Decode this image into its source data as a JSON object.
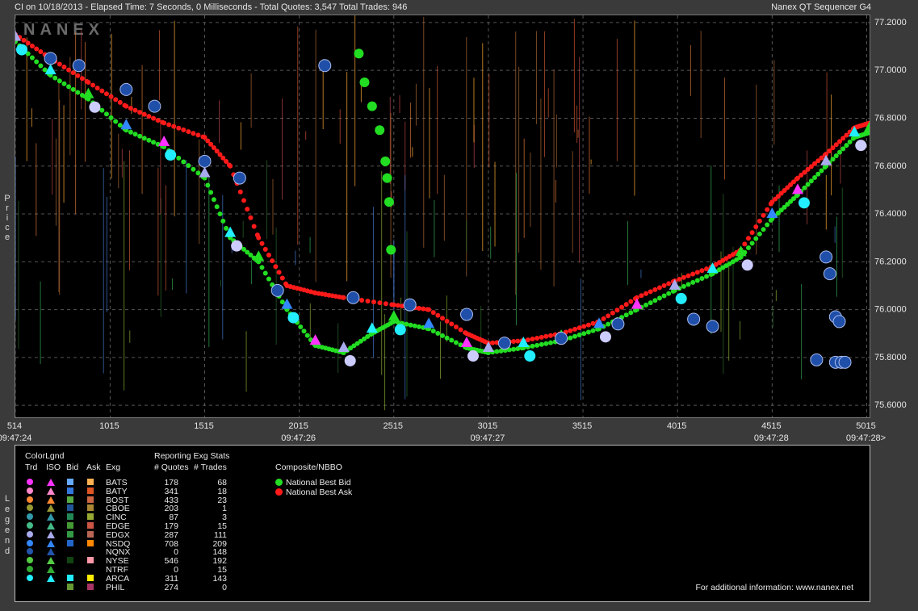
{
  "header": {
    "left": "CI on 10/18/2013  -  Elapsed Time: 7 Seconds, 0 Milliseconds  -  Total Quotes: 3,547  Total Trades: 946",
    "right": "Nanex QT Sequencer G4"
  },
  "watermark": "NANEX",
  "side_labels": {
    "price": "Price",
    "legend": "Legend"
  },
  "chart_data": {
    "type": "scatter",
    "ylim": [
      75.55,
      77.23
    ],
    "xlim": [
      514,
      5030
    ],
    "y_ticks": [
      "77.2000",
      "77.0000",
      "76.8000",
      "76.6000",
      "76.4000",
      "76.2000",
      "76.0000",
      "75.8000",
      "75.6000"
    ],
    "y_tick_values": [
      77.2,
      77.0,
      76.8,
      76.6,
      76.4,
      76.2,
      76.0,
      75.8,
      75.6
    ],
    "x_ticks": [
      "514",
      "1015",
      "1515",
      "2015",
      "2515",
      "3015",
      "3515",
      "4015",
      "4515",
      "5015"
    ],
    "x_tick_values": [
      514,
      1015,
      1515,
      2015,
      2515,
      3015,
      3515,
      4015,
      4515,
      5015
    ],
    "time_labels": [
      {
        "x": 514,
        "label": "09:47:24"
      },
      {
        "x": 2015,
        "label": "09:47:26"
      },
      {
        "x": 3015,
        "label": "09:47:27"
      },
      {
        "x": 4515,
        "label": "09:47:28"
      },
      {
        "x": 5015,
        "label": "09:47:28>"
      }
    ],
    "series": [
      {
        "name": "National Best Ask",
        "color": "#ff1a1a",
        "points": [
          [
            514,
            77.15
          ],
          [
            700,
            77.05
          ],
          [
            900,
            76.95
          ],
          [
            1100,
            76.85
          ],
          [
            1300,
            76.78
          ],
          [
            1515,
            76.72
          ],
          [
            1650,
            76.6
          ],
          [
            1800,
            76.3
          ],
          [
            1950,
            76.1
          ],
          [
            2100,
            76.07
          ],
          [
            2250,
            76.05
          ],
          [
            2515,
            76.02
          ],
          [
            2700,
            76.0
          ],
          [
            2900,
            75.9
          ],
          [
            3015,
            75.86
          ],
          [
            3200,
            75.87
          ],
          [
            3400,
            75.9
          ],
          [
            3600,
            75.95
          ],
          [
            3800,
            76.05
          ],
          [
            4000,
            76.12
          ],
          [
            4200,
            76.18
          ],
          [
            4350,
            76.25
          ],
          [
            4515,
            76.45
          ],
          [
            4650,
            76.55
          ],
          [
            4800,
            76.65
          ],
          [
            4950,
            76.76
          ],
          [
            5030,
            76.78
          ]
        ]
      },
      {
        "name": "National Best Bid",
        "color": "#22dd22",
        "points": [
          [
            514,
            77.12
          ],
          [
            700,
            76.98
          ],
          [
            900,
            76.88
          ],
          [
            1100,
            76.75
          ],
          [
            1300,
            76.68
          ],
          [
            1515,
            76.55
          ],
          [
            1650,
            76.3
          ],
          [
            1800,
            76.2
          ],
          [
            1950,
            76.0
          ],
          [
            2100,
            75.85
          ],
          [
            2250,
            75.82
          ],
          [
            2400,
            75.9
          ],
          [
            2515,
            75.95
          ],
          [
            2700,
            75.92
          ],
          [
            2900,
            75.84
          ],
          [
            3015,
            75.82
          ],
          [
            3200,
            75.84
          ],
          [
            3400,
            75.87
          ],
          [
            3600,
            75.92
          ],
          [
            3800,
            76.0
          ],
          [
            4000,
            76.08
          ],
          [
            4200,
            76.15
          ],
          [
            4350,
            76.22
          ],
          [
            4515,
            76.38
          ],
          [
            4650,
            76.48
          ],
          [
            4800,
            76.6
          ],
          [
            4950,
            76.72
          ],
          [
            5030,
            76.74
          ]
        ]
      },
      {
        "name": "Trades",
        "color": "#1f4fa8",
        "points": [
          [
            700,
            77.05
          ],
          [
            850,
            77.02
          ],
          [
            1100,
            76.92
          ],
          [
            1250,
            76.85
          ],
          [
            1515,
            76.62
          ],
          [
            1700,
            76.55
          ],
          [
            1900,
            76.08
          ],
          [
            2150,
            77.02
          ],
          [
            2300,
            76.05
          ],
          [
            2600,
            76.02
          ],
          [
            2900,
            75.98
          ],
          [
            3100,
            75.86
          ],
          [
            3400,
            75.88
          ],
          [
            3700,
            75.94
          ],
          [
            4100,
            75.96
          ],
          [
            4200,
            75.93
          ],
          [
            4800,
            76.22
          ],
          [
            4820,
            76.15
          ],
          [
            4850,
            75.97
          ],
          [
            4870,
            75.95
          ],
          [
            4750,
            75.79
          ],
          [
            4850,
            75.78
          ],
          [
            4880,
            75.78
          ],
          [
            4900,
            75.78
          ]
        ]
      }
    ],
    "green_spike": [
      [
        2330,
        77.07
      ],
      [
        2360,
        76.95
      ],
      [
        2400,
        76.85
      ],
      [
        2440,
        76.75
      ],
      [
        2470,
        76.62
      ],
      [
        2480,
        76.55
      ],
      [
        2490,
        76.45
      ],
      [
        2500,
        76.25
      ]
    ]
  },
  "legend": {
    "title": "ColorLgnd",
    "stats_title": "Reporting Exg Stats",
    "columns": [
      "Trd",
      "ISO",
      "Bid",
      "Ask",
      "Exg",
      "# Quotes",
      "# Trades"
    ],
    "composite_title": "Composite/NBBO",
    "composite_items": [
      {
        "label": "National Best Bid",
        "color": "#22dd22"
      },
      {
        "label": "National Best Ask",
        "color": "#ff1a1a"
      }
    ],
    "exchanges": [
      {
        "exg": "BATS",
        "quotes": "178",
        "trades": "68",
        "trd": "#ff33ff",
        "iso": "#ff33ff",
        "bid": "#66aaff",
        "ask": "#ffb050"
      },
      {
        "exg": "BATY",
        "quotes": "341",
        "trades": "18",
        "trd": "#ff88cc",
        "iso": "#ff88cc",
        "bid": "#3377dd",
        "ask": "#dd5522"
      },
      {
        "exg": "BOST",
        "quotes": "433",
        "trades": "23",
        "trd": "#ff8833",
        "iso": "#ff8833",
        "bid": "#55aa44",
        "ask": "#cc6644"
      },
      {
        "exg": "CBOE",
        "quotes": "203",
        "trades": "1",
        "trd": "#999933",
        "iso": "#999933",
        "bid": "#225599",
        "ask": "#aa8833"
      },
      {
        "exg": "CINC",
        "quotes": "87",
        "trades": "3",
        "trd": "#3399aa",
        "iso": "#3399aa",
        "bid": "#228855",
        "ask": "#99aa33"
      },
      {
        "exg": "EDGE",
        "quotes": "179",
        "trades": "15",
        "trd": "#44bb88",
        "iso": "#44bb88",
        "bid": "#449933",
        "ask": "#cc5544"
      },
      {
        "exg": "EDGX",
        "quotes": "287",
        "trades": "111",
        "trd": "#aaaaee",
        "iso": "#aaaaee",
        "bid": "#339944",
        "ask": "#bb6655"
      },
      {
        "exg": "NSDQ",
        "quotes": "708",
        "trades": "209",
        "trd": "#3388ff",
        "iso": "#3388ff",
        "bid": "#2266cc",
        "ask": "#ff8800"
      },
      {
        "exg": "NQNX",
        "quotes": "0",
        "trades": "148",
        "trd": "#2255aa",
        "iso": "#2255aa",
        "bid": "",
        "ask": ""
      },
      {
        "exg": "NYSE",
        "quotes": "546",
        "trades": "192",
        "trd": "#55cc44",
        "iso": "#55cc44",
        "bid": "#114411",
        "ask": "#ff99aa"
      },
      {
        "exg": "NTRF",
        "quotes": "0",
        "trades": "15",
        "trd": "#33aa33",
        "iso": "#33aa33",
        "bid": "",
        "ask": ""
      },
      {
        "exg": "ARCA",
        "quotes": "311",
        "trades": "143",
        "trd": "#22eeff",
        "iso": "#22eeff",
        "bid": "#22eeff",
        "ask": "#ffee00"
      },
      {
        "exg": "PHIL",
        "quotes": "274",
        "trades": "0",
        "trd": "",
        "iso": "",
        "bid": "#669933",
        "ask": "#aa3366"
      }
    ],
    "footer": "For additional information: www.nanex.net"
  }
}
